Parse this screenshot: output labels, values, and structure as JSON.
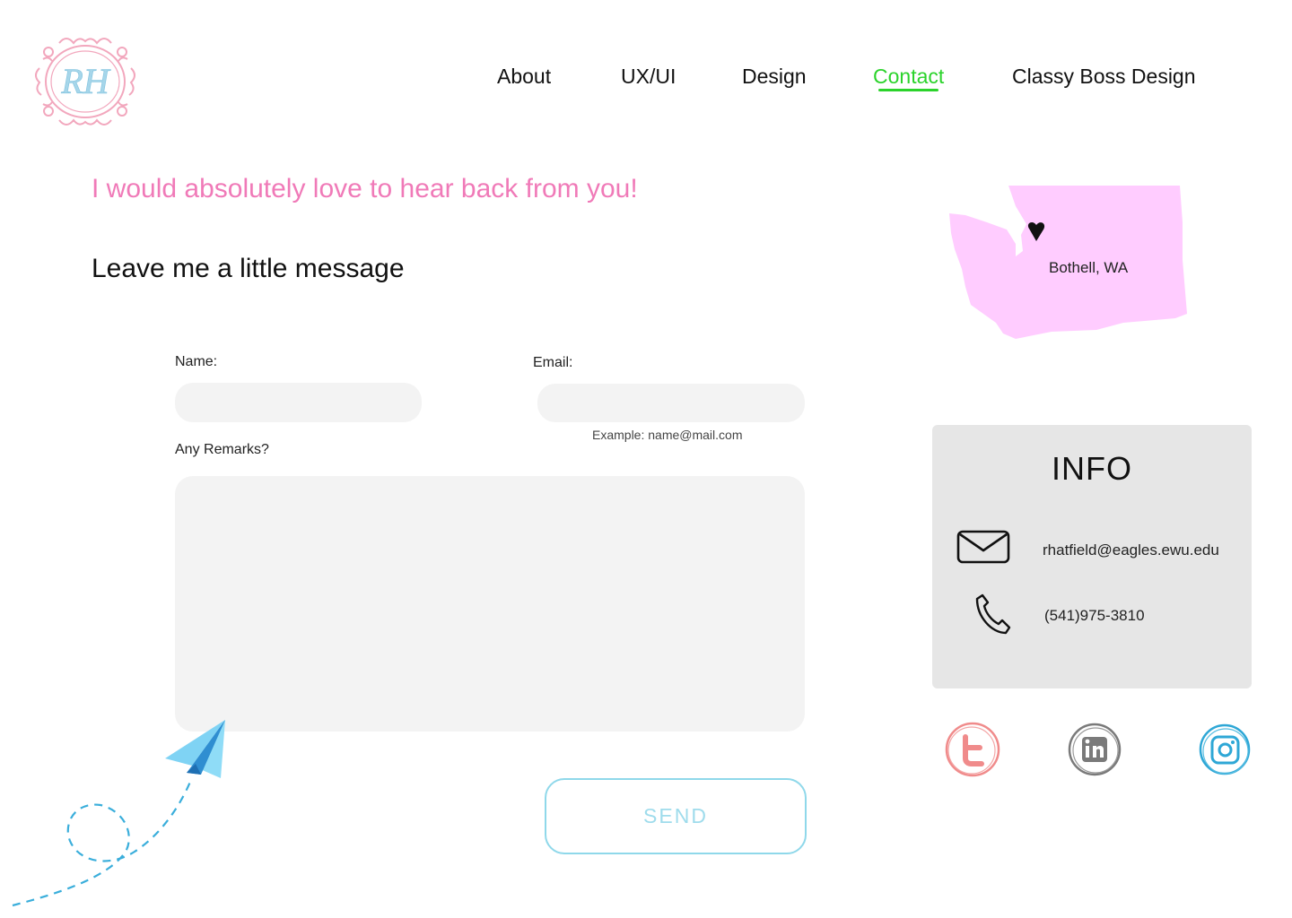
{
  "logo": {
    "text": "RH"
  },
  "nav": {
    "items": [
      {
        "label": "About"
      },
      {
        "label": "UX/UI"
      },
      {
        "label": "Design"
      },
      {
        "label": "Contact"
      },
      {
        "label": "Classy Boss Design"
      }
    ],
    "active": "Contact"
  },
  "headline": "I would absolutely love to hear back from you!",
  "subheading": "Leave me a little message",
  "form": {
    "name_label": "Name:",
    "name_value": "",
    "email_label": "Email:",
    "email_value": "",
    "email_hint": "Example: name@mail.com",
    "remarks_label": "Any Remarks?",
    "remarks_value": "",
    "send_label": "SEND"
  },
  "map": {
    "location": "Bothell, WA",
    "fill_color": "#ffccff"
  },
  "info": {
    "title": "INFO",
    "email": "rhatfield@eagles.ewu.edu",
    "phone": "(541)975-3810"
  },
  "social": [
    {
      "icon": "twitter-icon",
      "color": "#f08b8b"
    },
    {
      "icon": "linkedin-icon",
      "color": "#7a7a7a"
    },
    {
      "icon": "instagram-icon",
      "color": "#2ea7d6"
    }
  ],
  "colors": {
    "accent_pink": "#f07ab8",
    "nav_active": "#2bd32b",
    "send_border": "#8fd8ea"
  }
}
